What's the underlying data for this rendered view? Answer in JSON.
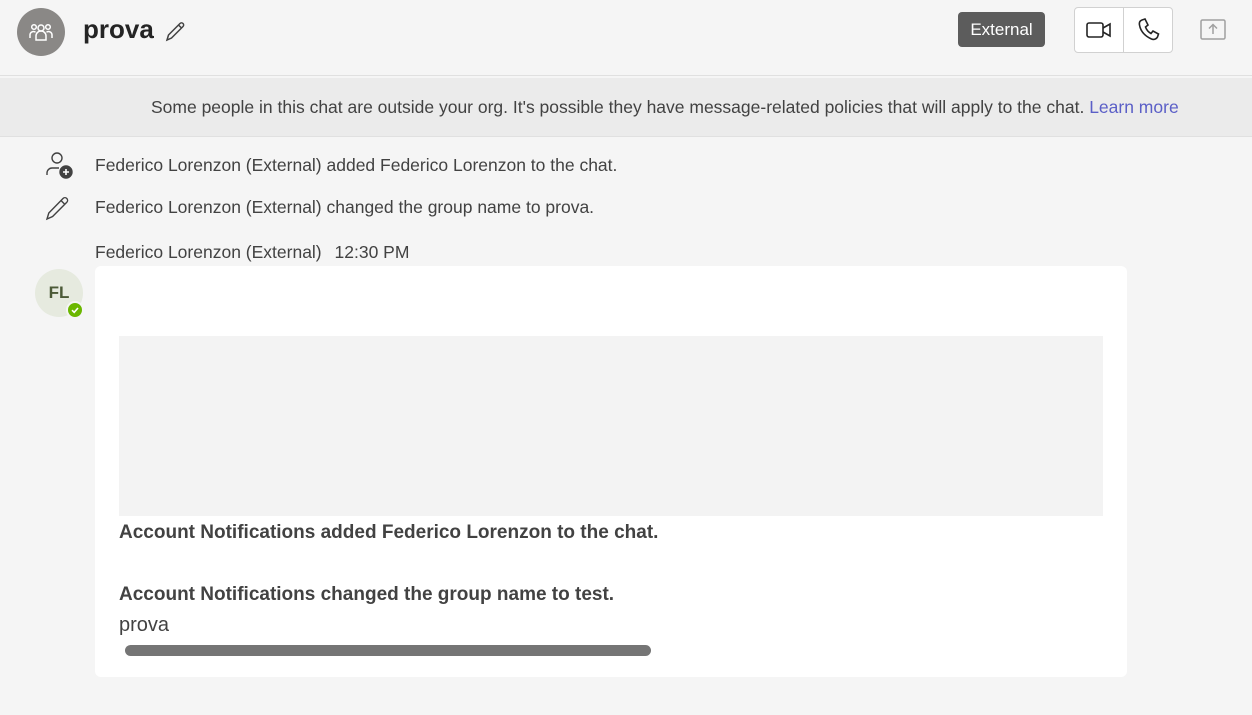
{
  "header": {
    "title": "prova",
    "external_badge": "External",
    "icons": {
      "group": "people-group-icon",
      "edit": "pencil-icon",
      "video": "video-camera-icon",
      "call": "phone-icon",
      "share": "share-screen-icon"
    }
  },
  "banner": {
    "text": "Some people in this chat are outside your org. It's possible they have message-related policies that will apply to the chat.",
    "link": "Learn more"
  },
  "system_events": [
    {
      "icon": "person-add-icon",
      "text": "Federico Lorenzon (External) added Federico Lorenzon to the chat."
    },
    {
      "icon": "pencil-icon",
      "text": "Federico Lorenzon (External) changed the group name to prova."
    }
  ],
  "message": {
    "sender": "Federico Lorenzon (External)",
    "time": "12:30 PM",
    "avatar_initials": "FL",
    "presence": "available",
    "lines": [
      "Account Notifications added Federico Lorenzon to the chat.",
      "Account Notifications changed the group name to test.",
      "prova"
    ]
  },
  "colors": {
    "accent_link": "#5b5fc7",
    "presence_available": "#6bb700",
    "badge_bg": "#5c5c5c"
  }
}
